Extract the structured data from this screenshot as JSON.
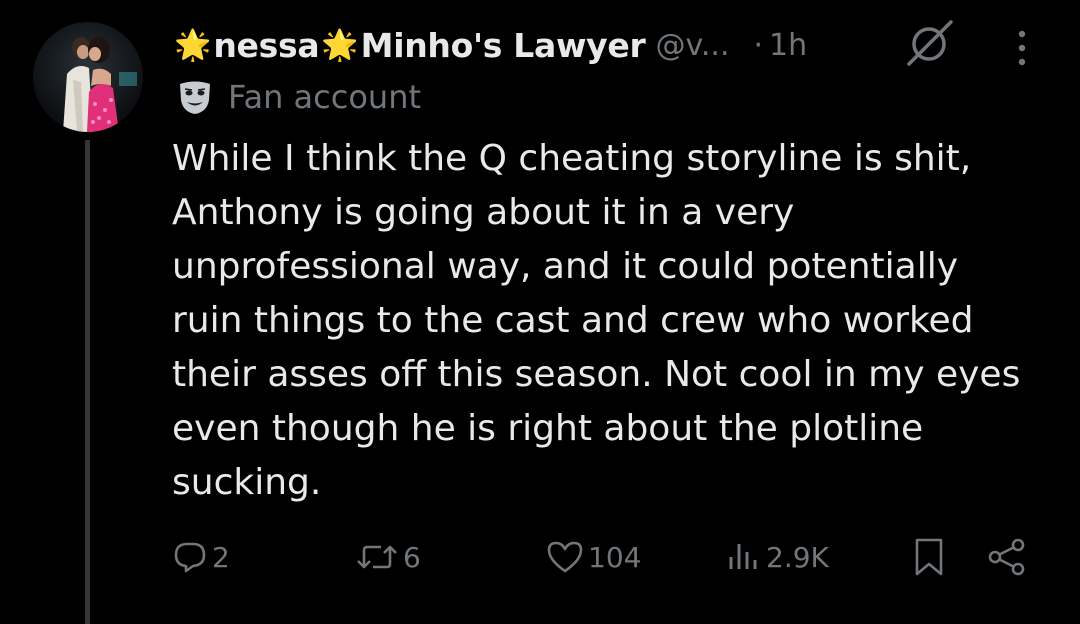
{
  "post": {
    "author": {
      "name_part1": "nessa",
      "name_part2": "Minho's Lawyer",
      "handle": "@v...",
      "label": "Fan account"
    },
    "dot": "·",
    "time": "1h",
    "text_lines": [
      "While I think the Q cheating storyline is shit,",
      "Anthony is going about it in a very",
      "unprofessional way, and it could potentially",
      "ruin things to the cast and crew who worked",
      "their asses off this season. Not cool in my eyes",
      "even though he is right about the plotline",
      "sucking."
    ],
    "stats": {
      "replies": "2",
      "reposts": "6",
      "likes": "104",
      "views": "2.9K"
    }
  },
  "colors": {
    "background": "#000000",
    "text": "#e7e9ea",
    "secondary": "#71767b",
    "star": "#f5c518",
    "thread_line": "#333639"
  },
  "icons": {
    "star": "glowing-star-emoji",
    "grok": "grok-icon",
    "more": "more-vertical-icon",
    "label": "performing-arts-mask-icon",
    "reply": "reply-icon",
    "repost": "repost-icon",
    "like": "like-heart-icon",
    "views": "views-bar-chart-icon",
    "bookmark": "bookmark-icon",
    "share": "share-icon"
  }
}
